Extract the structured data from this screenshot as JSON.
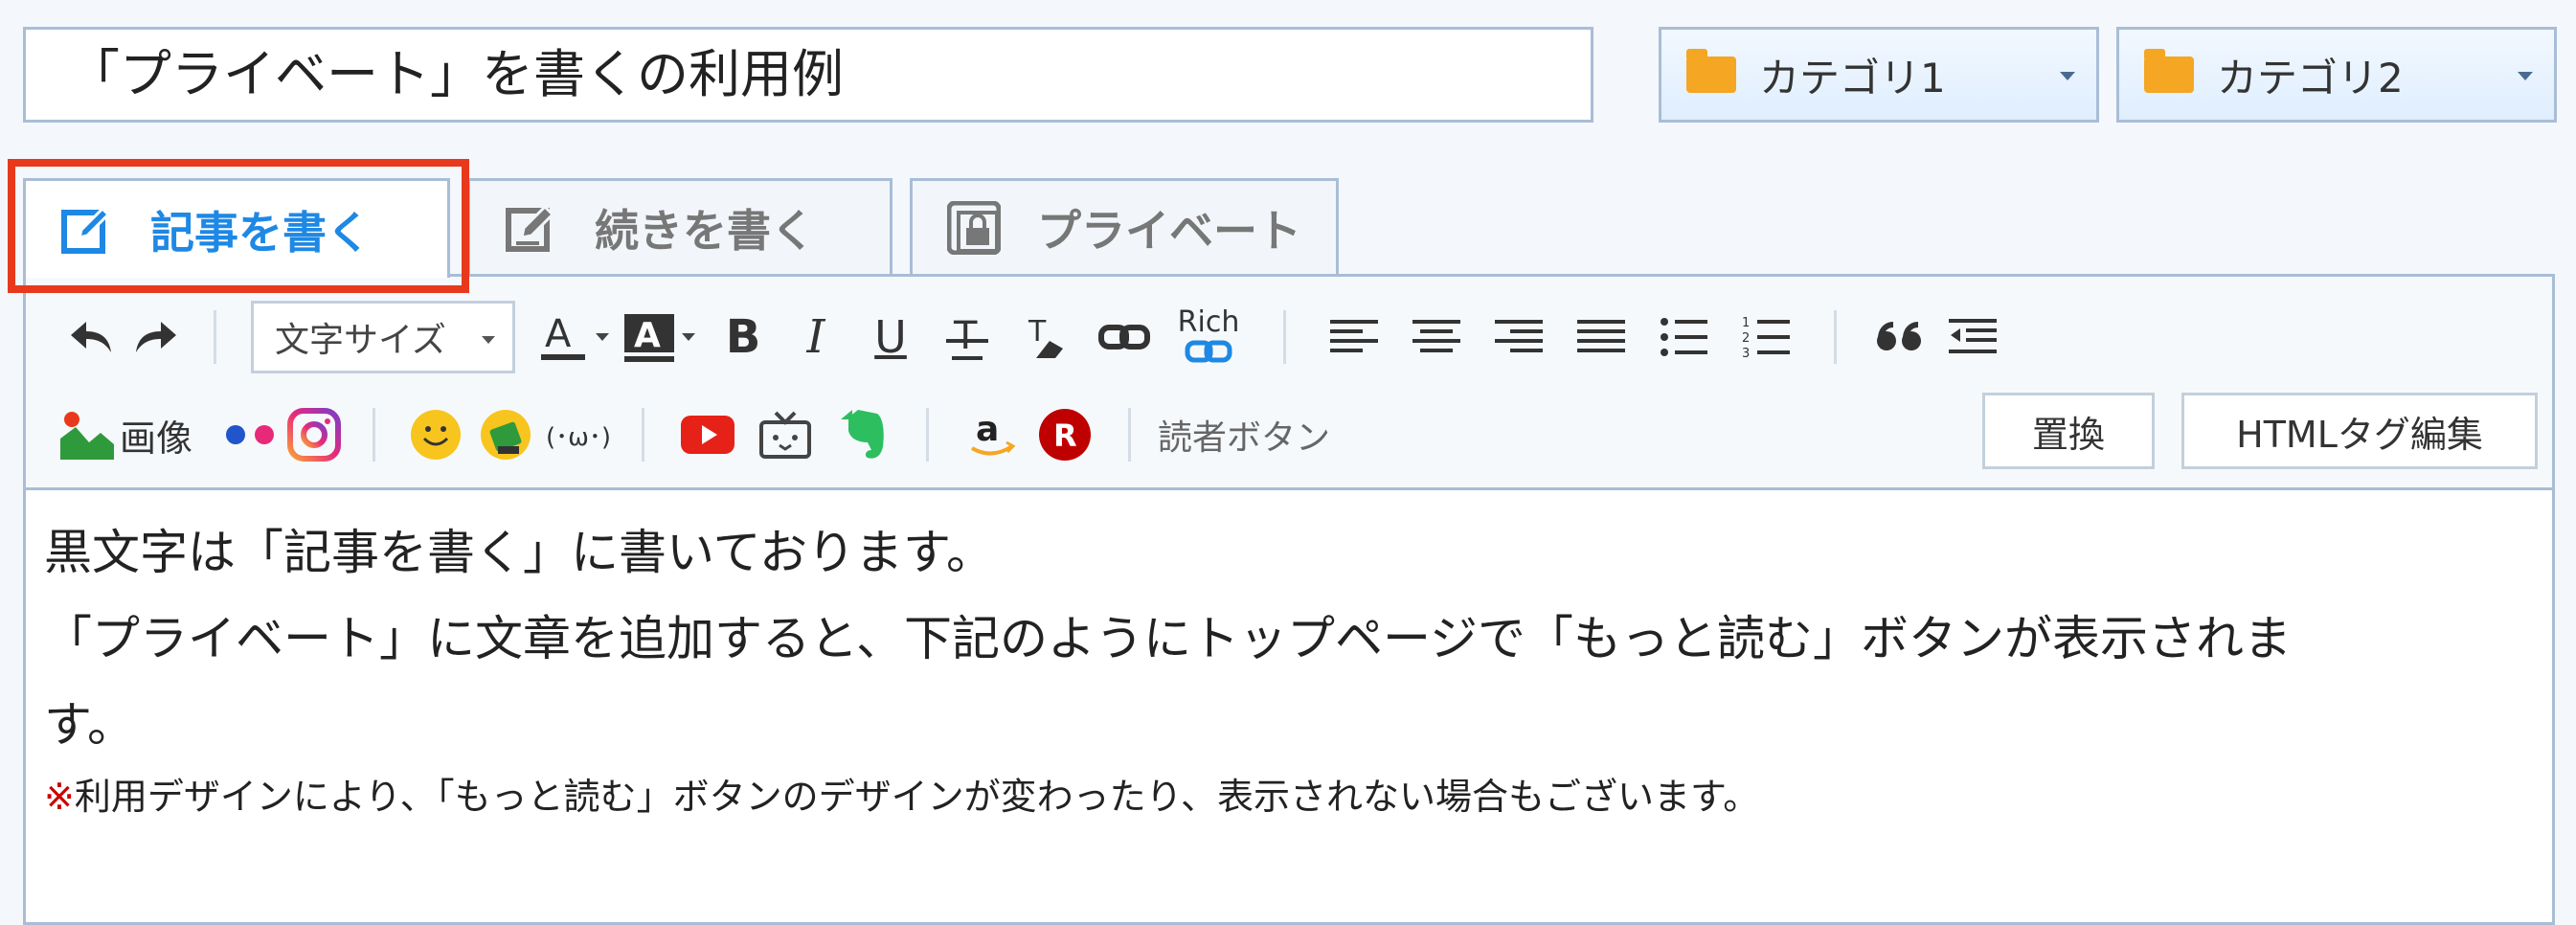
{
  "title": {
    "value": "「プライベート」を書くの利用例"
  },
  "categories": [
    {
      "label": "カテゴリ1",
      "icon": "folder-icon"
    },
    {
      "label": "カテゴリ2",
      "icon": "folder-icon"
    }
  ],
  "tabs": [
    {
      "label": "記事を書く",
      "icon": "edit-icon",
      "active": true
    },
    {
      "label": "続きを書く",
      "icon": "edit-continue-icon",
      "active": false
    },
    {
      "label": "プライベート",
      "icon": "lock-icon",
      "active": false
    }
  ],
  "toolbar": {
    "font_size_label": "文字サイズ",
    "rich_label": "Rich",
    "image_label": "画像",
    "reader_button_label": "読者ボタン",
    "replace_label": "置換",
    "html_edit_label": "HTMLタグ編集",
    "emoticon_label": "(･ω･)"
  },
  "content": {
    "line1": "黒文字は「記事を書く」に書いております。",
    "line2": "「プライベート」に文章を追加すると、下記のようにトップページで「もっと読む」ボタンが表示されま",
    "line3": "す。",
    "note_mark": "※",
    "note_text": "利用デザインにより、「もっと読む」ボタンのデザインが変わったり、表示されない場合もございます。"
  },
  "colors": {
    "accent": "#1e88e5",
    "highlight": "#e8391d",
    "folder": "#f5a623",
    "border": "#a9bdd6"
  }
}
